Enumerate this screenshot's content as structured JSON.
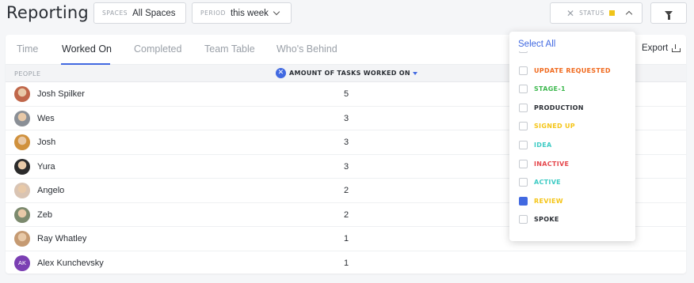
{
  "header": {
    "title": "Reporting",
    "spaces_label": "SPACES",
    "spaces_value": "All Spaces",
    "period_label": "PERIOD",
    "period_value": "this week",
    "status_label": "STATUS",
    "status_color": "#f0c419"
  },
  "tabs": [
    {
      "label": "Time"
    },
    {
      "label": "Worked On"
    },
    {
      "label": "Completed"
    },
    {
      "label": "Team Table"
    },
    {
      "label": "Who's Behind"
    }
  ],
  "active_tab": "Worked On",
  "export_label": "Export",
  "table": {
    "col_people": "PEOPLE",
    "col_amount": "AMOUNT OF TASKS WORKED ON",
    "rows": [
      {
        "name": "Josh Spilker",
        "count": "5",
        "avatar_color": "#c0674a"
      },
      {
        "name": "Wes",
        "count": "3",
        "avatar_color": "#8a8f96"
      },
      {
        "name": "Josh",
        "count": "3",
        "avatar_color": "#d0913d"
      },
      {
        "name": "Yura",
        "count": "3",
        "avatar_color": "#2b2b2b"
      },
      {
        "name": "Angelo",
        "count": "2",
        "avatar_color": "#d9c4b3"
      },
      {
        "name": "Zeb",
        "count": "2",
        "avatar_color": "#7c8a6e"
      },
      {
        "name": "Ray Whatley",
        "count": "1",
        "avatar_color": "#c59a72"
      },
      {
        "name": "Alex Kunchevsky",
        "count": "1",
        "avatar_initials": "AK",
        "avatar_color": "#7b3fb3"
      }
    ]
  },
  "status_dropdown": {
    "select_all": "Select All",
    "items": [
      {
        "label": "UPDATE REQUESTED",
        "color": "#f06a1e",
        "checked": false
      },
      {
        "label": "STAGE-1",
        "color": "#3fb950",
        "checked": false
      },
      {
        "label": "PRODUCTION",
        "color": "#2a2e34",
        "checked": false
      },
      {
        "label": "SIGNED UP",
        "color": "#f5c518",
        "checked": false
      },
      {
        "label": "IDEA",
        "color": "#3ecbc4",
        "checked": false
      },
      {
        "label": "INACTIVE",
        "color": "#e5484d",
        "checked": false
      },
      {
        "label": "ACTIVE",
        "color": "#3ecbc4",
        "checked": false
      },
      {
        "label": "REVIEW",
        "color": "#f5c518",
        "checked": true
      },
      {
        "label": "SPOKE",
        "color": "#2a2e34",
        "checked": false
      }
    ]
  }
}
